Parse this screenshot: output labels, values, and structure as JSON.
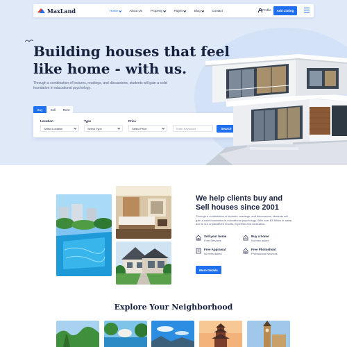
{
  "brand": {
    "name": "MaxLand",
    "accent": "#1f6ff0",
    "logo_red": "#e0342c"
  },
  "nav": {
    "items": [
      {
        "label": "Home",
        "has_dropdown": true,
        "active": true
      },
      {
        "label": "About Us",
        "has_dropdown": false,
        "active": false
      },
      {
        "label": "Property",
        "has_dropdown": true,
        "active": false
      },
      {
        "label": "Pages",
        "has_dropdown": true,
        "active": false
      },
      {
        "label": "Blog",
        "has_dropdown": true,
        "active": false
      },
      {
        "label": "Contact",
        "has_dropdown": false,
        "active": false
      }
    ],
    "profile_label": "Profile",
    "add_listing_label": "Add Listing"
  },
  "hero": {
    "title_line1": "Building houses that feel",
    "title_line2": "like home - with us.",
    "description": "Through a combination of lectures, readings, and discussions, students will gain a solid foundation in educational psychology."
  },
  "search": {
    "tabs": [
      "Buy",
      "Sell",
      "Rent"
    ],
    "active_tab": "Buy",
    "fields": [
      {
        "label": "Location",
        "value": "Select Location"
      },
      {
        "label": "Type",
        "value": "Select Type"
      },
      {
        "label": "Price",
        "value": "Select Price"
      }
    ],
    "keyword_placeholder": "Enter Keywords",
    "button_label": "Search"
  },
  "about": {
    "title_line1": "We help clients buy and",
    "title_line2": "Sell houses since 2001",
    "description": "Through a combination of lectures, readings, and discussions, students will gain a solid foundation in educational psychology. With over $3 Billion in sales, due to our unparalleled results, expertise and dedication.",
    "features": [
      {
        "title": "Sell your home",
        "subtitle": "Free Services",
        "icon": "home-icon"
      },
      {
        "title": "Buy a home",
        "subtitle": "No fees asked",
        "icon": "buy-home-icon"
      },
      {
        "title": "Free Appraisal",
        "subtitle": "No fees asked",
        "icon": "appraisal-icon"
      },
      {
        "title": "Free Photoshoot",
        "subtitle": "Professional services",
        "icon": "photoshoot-icon"
      }
    ],
    "button_label": "More Details"
  },
  "neighborhood": {
    "title": "Explore Your Neighborhood",
    "card_count_visible": 5
  }
}
